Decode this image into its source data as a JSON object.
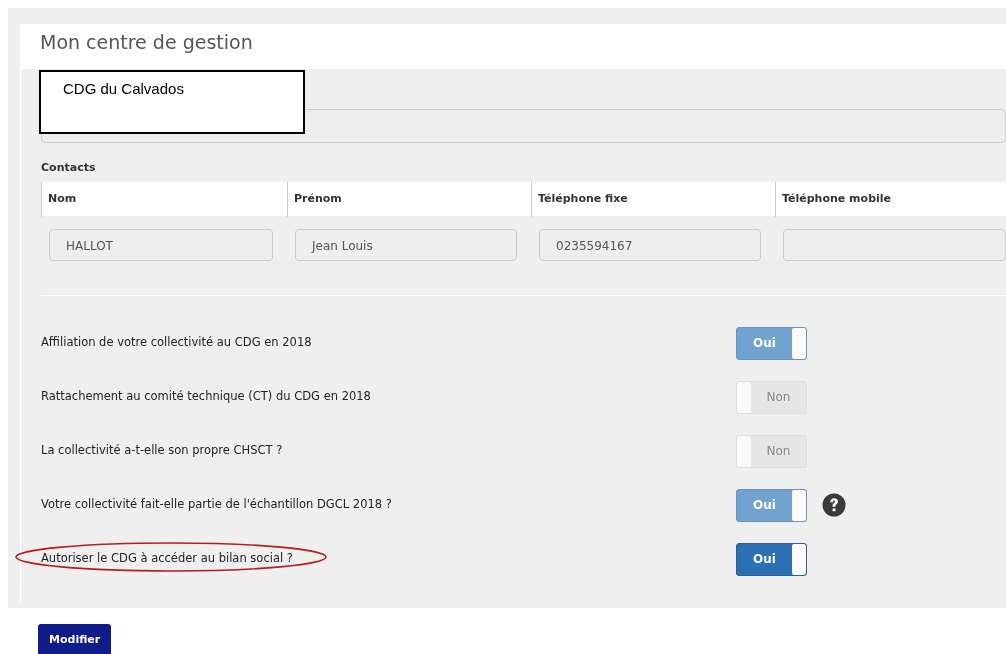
{
  "panel": {
    "title": "Mon centre de gestion"
  },
  "centre": {
    "name": "CDG du Calvados"
  },
  "contacts": {
    "label": "Contacts",
    "columns": [
      "Nom",
      "Prénom",
      "Téléphone fixe",
      "Téléphone mobile"
    ],
    "values": [
      "HALLOT",
      "Jean Louis",
      "0235594167"
    ]
  },
  "questions": [
    {
      "label": "Affiliation de votre collectivité au CDG en 2018",
      "on": true,
      "disabled": true,
      "toggle_text": "Oui",
      "help": false,
      "circled": false
    },
    {
      "label": "Rattachement au comité technique (CT) du CDG en 2018",
      "on": false,
      "disabled": true,
      "toggle_text": "Non",
      "help": false,
      "circled": false
    },
    {
      "label": "La collectivité a-t-elle son propre CHSCT ?",
      "on": false,
      "disabled": true,
      "toggle_text": "Non",
      "help": false,
      "circled": false
    },
    {
      "label": "Votre collectivité fait-elle partie de l'échantillon DGCL 2018 ?",
      "on": true,
      "disabled": true,
      "toggle_text": "Oui",
      "help": true,
      "circled": false
    },
    {
      "label": "Autoriser le CDG à accéder au bilan social ?",
      "on": true,
      "disabled": false,
      "toggle_text": "Oui",
      "help": false,
      "circled": true
    }
  ],
  "button": {
    "label": "Modifier"
  }
}
